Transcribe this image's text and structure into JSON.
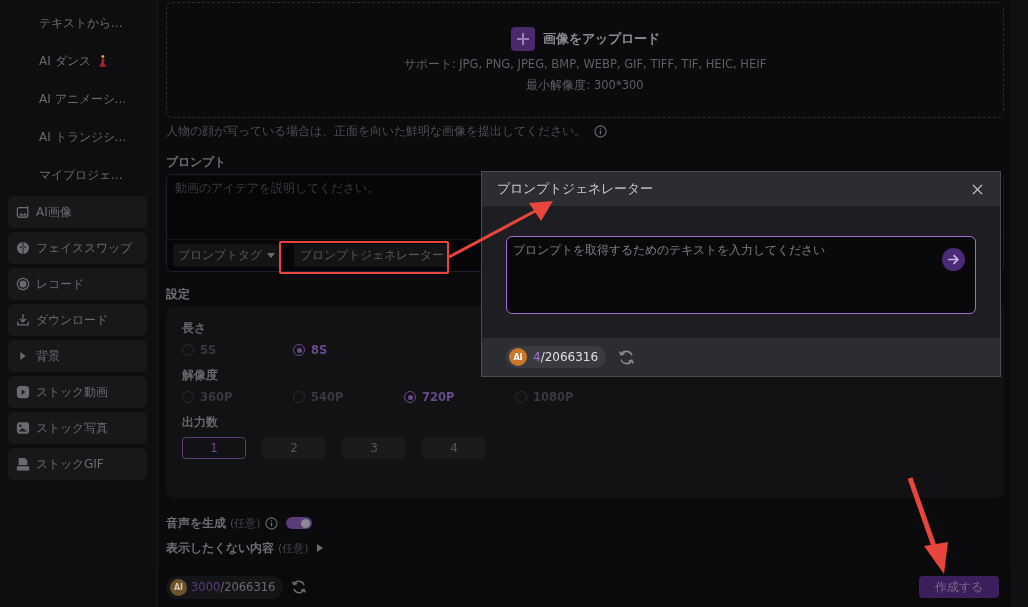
{
  "sidebar": {
    "items": [
      {
        "label": "テキストから...",
        "kind": "sub"
      },
      {
        "label": "AI ダンス",
        "kind": "sub",
        "emoji": true
      },
      {
        "label": "AI アニメーシ...",
        "kind": "sub"
      },
      {
        "label": "AI トランジシ...",
        "kind": "sub"
      },
      {
        "label": "マイプロジェ...",
        "kind": "sub"
      },
      {
        "label": "AI画像",
        "kind": "main"
      },
      {
        "label": "フェイススワップ",
        "kind": "main"
      },
      {
        "label": "レコード",
        "kind": "main"
      },
      {
        "label": "ダウンロード",
        "kind": "main"
      },
      {
        "label": "背景",
        "kind": "main"
      },
      {
        "label": "ストック動画",
        "kind": "main"
      },
      {
        "label": "ストック写真",
        "kind": "main"
      },
      {
        "label": "ストックGIF",
        "kind": "main"
      }
    ]
  },
  "upload": {
    "title": "画像をアップロード",
    "support": "サポート: JPG, PNG, JPEG, BMP, WEBP, GIF, TIFF, TIF, HEIC, HEIF",
    "min_resolution": "最小解像度: 300*300",
    "note": "人物の顔が写っている場合は、正面を向いた鮮明な画像を提出してください。"
  },
  "prompt": {
    "label": "プロンプト",
    "placeholder": "動画のアイデアを説明してください。",
    "tag_button": "プロンプトタグ",
    "generator_button": "プロンプトジェネレーター"
  },
  "settings": {
    "label": "設定",
    "groups": [
      {
        "label": "長さ",
        "kind": "radio",
        "options": [
          {
            "label": "5S",
            "selected": false
          },
          {
            "label": "8S",
            "selected": true
          }
        ]
      },
      {
        "label": "解像度",
        "kind": "radio",
        "options": [
          {
            "label": "360P",
            "selected": false
          },
          {
            "label": "540P",
            "selected": false
          },
          {
            "label": "720P",
            "selected": true
          },
          {
            "label": "1080P",
            "selected": false
          }
        ]
      },
      {
        "label": "出力数",
        "kind": "buttons",
        "options": [
          {
            "label": "1",
            "selected": true
          },
          {
            "label": "2",
            "selected": false
          },
          {
            "label": "3",
            "selected": false
          },
          {
            "label": "4",
            "selected": false
          }
        ]
      }
    ]
  },
  "audio": {
    "label": "音声を生成",
    "optional": "(任意)",
    "on": true
  },
  "exclude": {
    "label": "表示したくない内容",
    "optional": "(任意)"
  },
  "footer": {
    "coin": "AI",
    "used": "3000",
    "total": "/2066316",
    "create_button": "作成する"
  },
  "modal": {
    "coin": "AI",
    "title": "プロンプトジェネレーター",
    "placeholder": "プロンプトを取得するためのテキストを入力してください",
    "used": "4",
    "total": "/2066316"
  }
}
